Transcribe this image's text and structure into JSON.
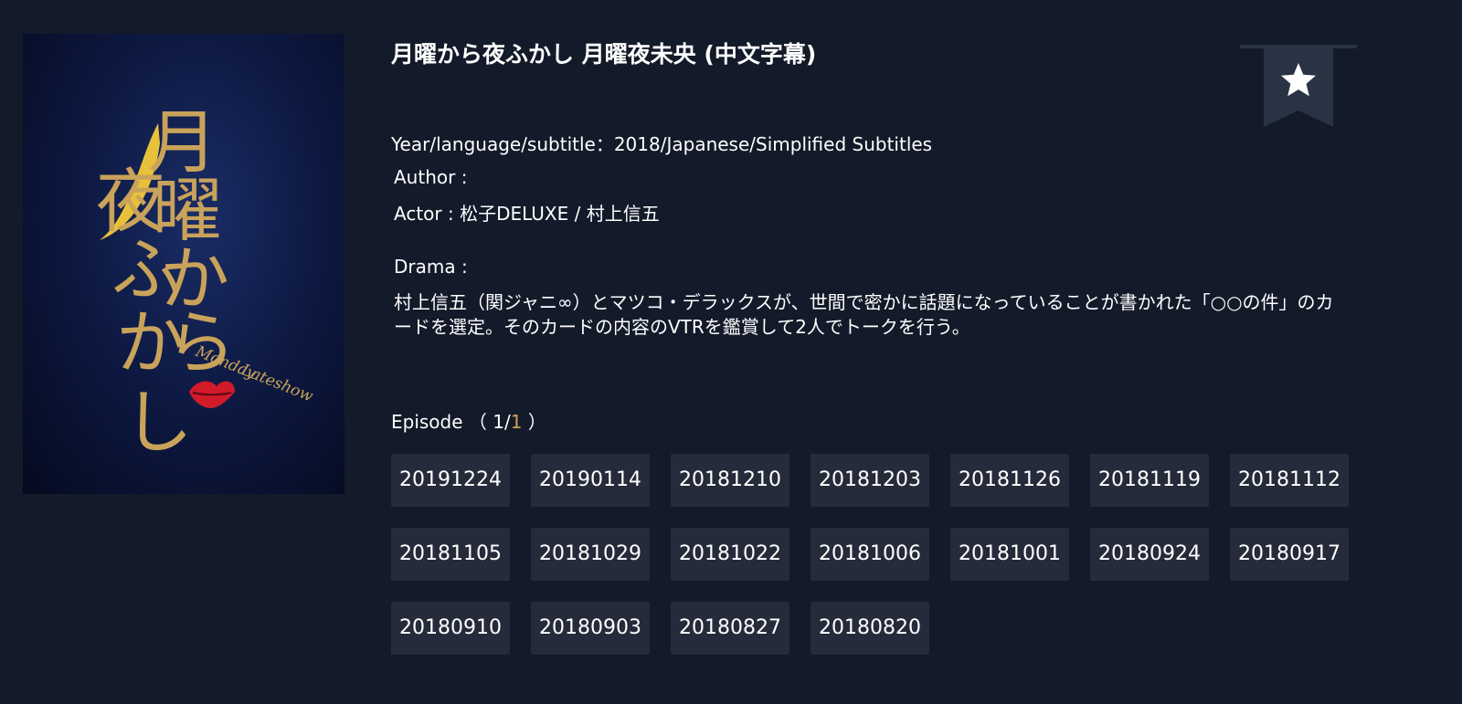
{
  "poster": {
    "title_glyphs": [
      "月",
      "曜",
      "か",
      "ら",
      "夜",
      "ふ",
      "か",
      "し"
    ],
    "script_line1": "Monday",
    "script_line2": "Lateshow",
    "colors": {
      "gold": "#c9a35a",
      "moon": "#e8c13a",
      "lips": "#d11a2a"
    }
  },
  "show": {
    "title": "月曜から夜ふかし 月曜夜未央 (中文字幕)",
    "year_lang_sub": "Year/language/subtitle：2018/Japanese/Simplified Subtitles",
    "author": "Author :",
    "actor": "Actor :   松子DELUXE / 村上信五",
    "drama_label": "Drama :",
    "description": "村上信五（関ジャニ∞）とマツコ・デラックスが、世間で密かに話題になっていることが書かれた「○○の件」のカードを選定。そのカードの内容のVTRを鑑賞して2人でトークを行う。"
  },
  "episodes": {
    "label": "Episode",
    "paren_open": "（ ",
    "current_page": "1",
    "sep": "/",
    "total_pages": "1",
    "paren_close": " ）",
    "items": [
      "20191224",
      "20190114",
      "20181210",
      "20181203",
      "20181126",
      "20181119",
      "20181112",
      "20181105",
      "20181029",
      "20181022",
      "20181006",
      "20181001",
      "20180924",
      "20180917",
      "20180910",
      "20180903",
      "20180827",
      "20180820"
    ]
  },
  "bookmark": {
    "icon": "star-icon",
    "color": "#2a3344"
  },
  "theme": {
    "background": "#131a29",
    "button_bg": "#252b3a"
  }
}
